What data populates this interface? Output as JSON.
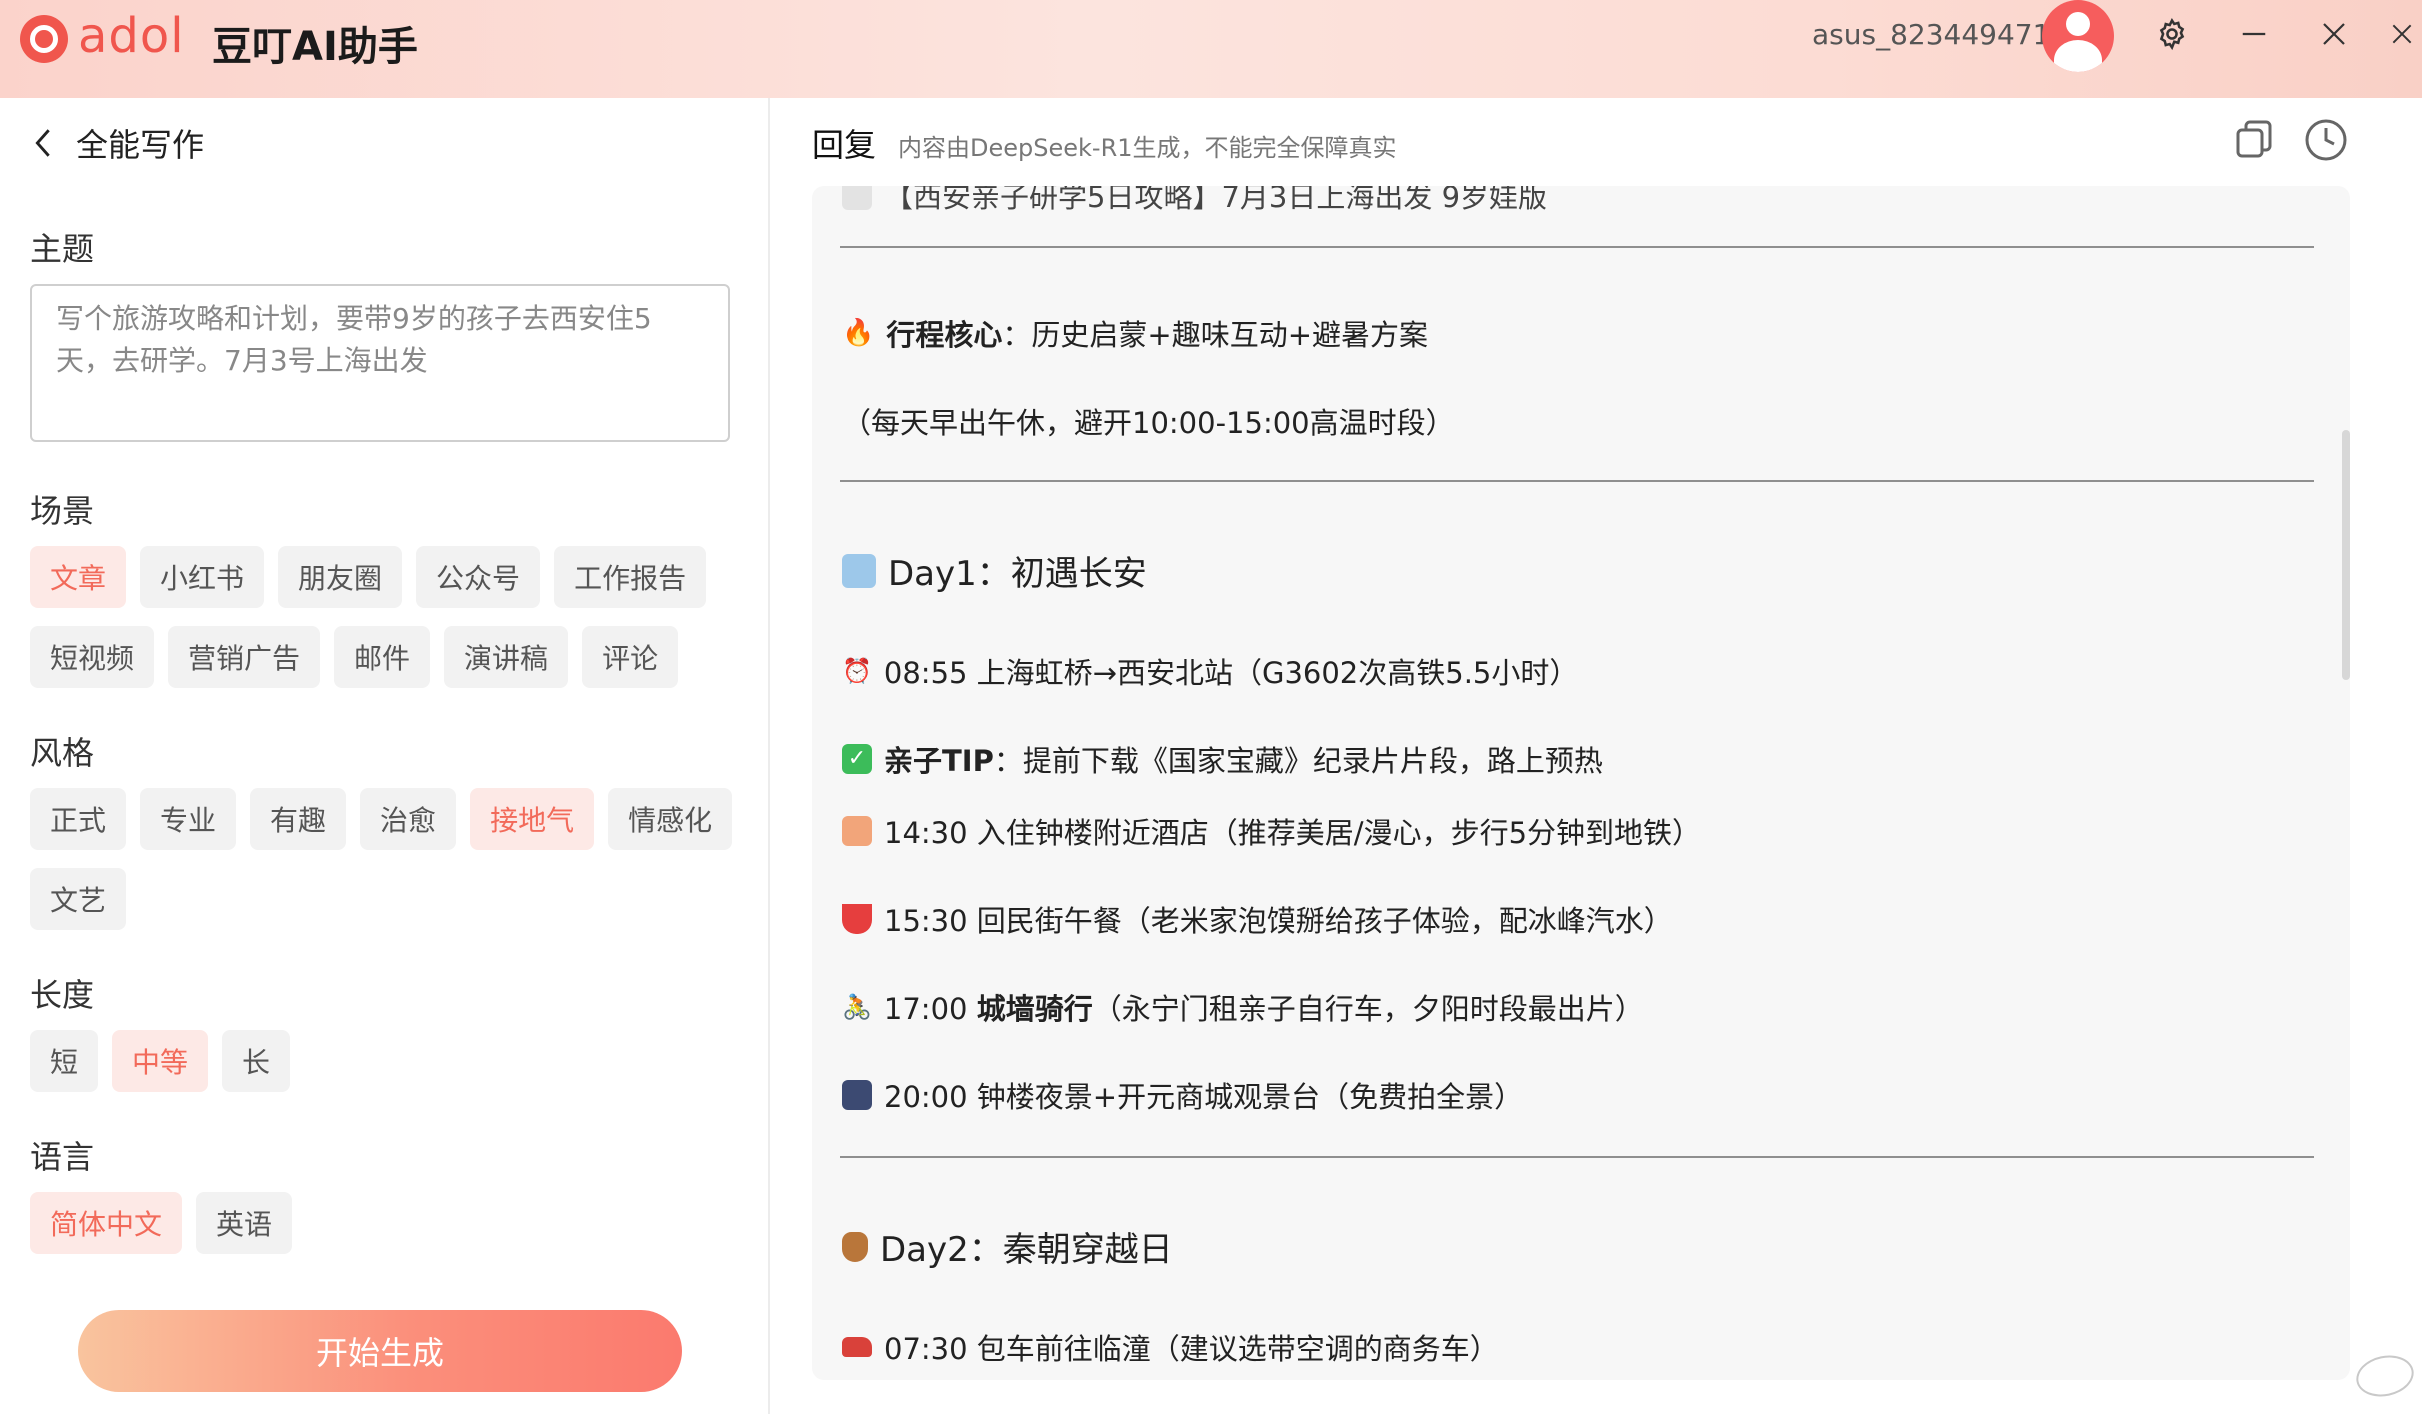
{
  "titlebar": {
    "logo_text": "adol",
    "app_title": "豆叮AI助手",
    "username": "asus_823449471",
    "icons": [
      "avatar",
      "gear-icon",
      "minimize-icon",
      "close-icon"
    ]
  },
  "left": {
    "back_label": "全能写作",
    "topic": {
      "label": "主题",
      "value": "写个旅游攻略和计划，要带9岁的孩子去西安住5天，去研学。7月3号上海出发"
    },
    "scene": {
      "label": "场景",
      "options": [
        "文章",
        "小红书",
        "朋友圈",
        "公众号",
        "工作报告",
        "短视频",
        "营销广告",
        "邮件",
        "演讲稿",
        "评论"
      ],
      "selected": "文章"
    },
    "style": {
      "label": "风格",
      "options": [
        "正式",
        "专业",
        "有趣",
        "治愈",
        "接地气",
        "情感化",
        "文艺"
      ],
      "selected": "接地气"
    },
    "length": {
      "label": "长度",
      "options": [
        "短",
        "中等",
        "长"
      ],
      "selected": "中等"
    },
    "language": {
      "label": "语言",
      "options": [
        "简体中文",
        "英语"
      ],
      "selected": "简体中文"
    },
    "generate_label": "开始生成"
  },
  "reply": {
    "title": "回复",
    "subtitle": "内容由DeepSeek-R1生成，不能完全保障真实",
    "icons": [
      "copy-icon",
      "history-icon"
    ],
    "lines": {
      "cut_top": "【西安亲子研学5日攻略】7月3日上海出发 9岁娃版",
      "core_label": "行程核心",
      "core_text": "：历史启蒙+趣味互动+避暑方案",
      "core_note": "（每天早出午休，避开10:00-15:00高温时段）",
      "day1_title": "Day1：初遇长安",
      "d1_1": "08:55 上海虹桥→西安北站（G3602次高铁5.5小时）",
      "d1_tip_label": "亲子TIP",
      "d1_tip_text": "：提前下载《国家宝藏》纪录片片段，路上预热",
      "d1_2": "14:30 入住钟楼附近酒店（推荐美居/漫心，步行5分钟到地铁）",
      "d1_3": "15:30 回民街午餐（老米家泡馍掰给孩子体验，配冰峰汽水）",
      "d1_4_time": "17:00 ",
      "d1_4_bold": "城墙骑行",
      "d1_4_rest": "（永宁门租亲子自行车，夕阳时段最出片）",
      "d1_5": "20:00 钟楼夜景+开元商城观景台（免费拍全景）",
      "day2_title": "Day2：秦朝穿越日",
      "d2_1": "07:30 包车前往临潼（建议选带空调的商务车）"
    }
  },
  "colors": {
    "accent": "#f26a5a",
    "chip_selected_bg": "#fde9e6",
    "chip_bg": "#f2f2f2"
  }
}
